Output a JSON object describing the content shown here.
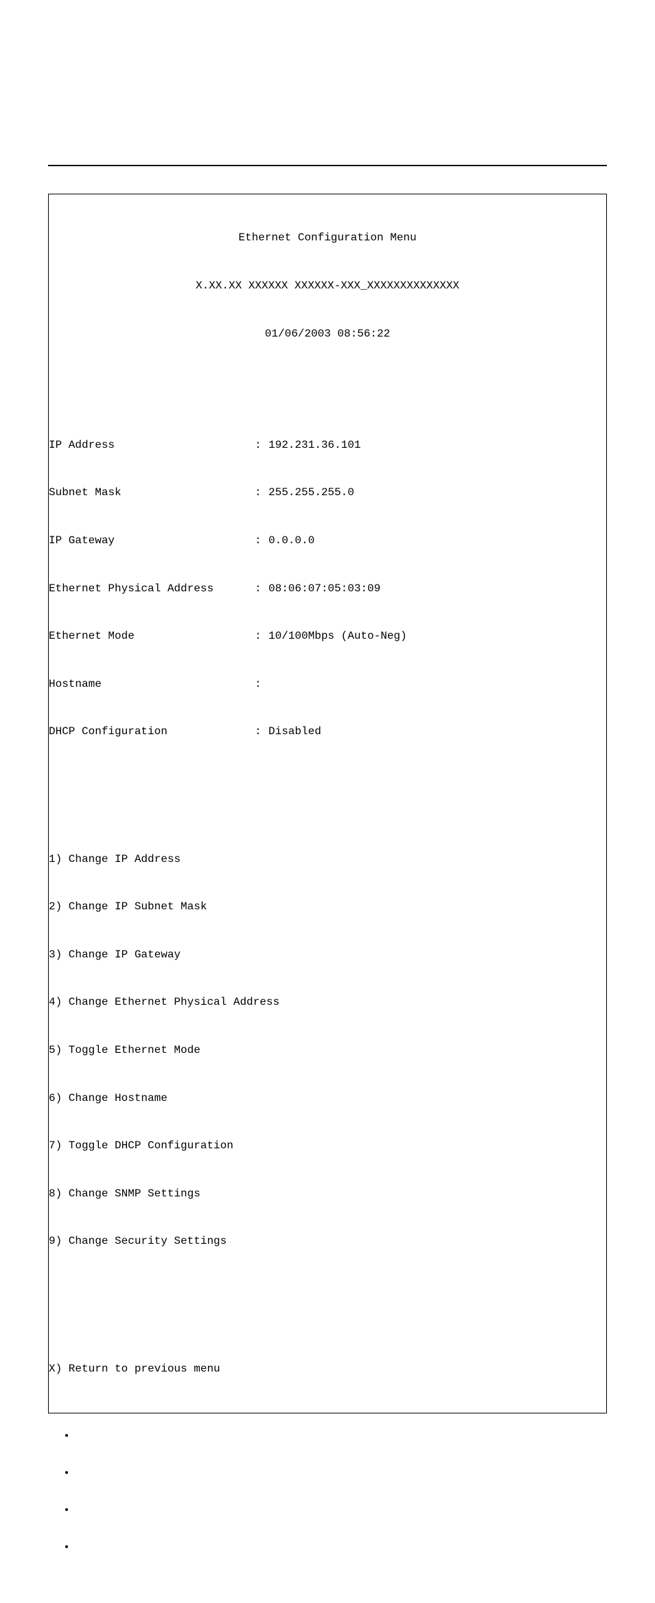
{
  "terminal": {
    "title": "Ethernet Configuration Menu",
    "version_line": "X.XX.XX XXXXXX XXXXXX-XXX_XXXXXXXXXXXXXX",
    "datetime": "01/06/2003 08:56:22",
    "fields": [
      {
        "label": "IP Address",
        "value": "192.231.36.101"
      },
      {
        "label": "Subnet Mask",
        "value": "255.255.255.0"
      },
      {
        "label": "IP Gateway",
        "value": "0.0.0.0"
      },
      {
        "label": "Ethernet Physical Address",
        "value": "08:06:07:05:03:09"
      },
      {
        "label": "Ethernet Mode",
        "value": "10/100Mbps (Auto-Neg)"
      },
      {
        "label": "Hostname",
        "value": ""
      },
      {
        "label": "DHCP Configuration",
        "value": "Disabled"
      }
    ],
    "menu": [
      "1) Change IP Address",
      "2) Change IP Subnet Mask",
      "3) Change IP Gateway",
      "4) Change Ethernet Physical Address",
      "5) Toggle Ethernet Mode",
      "6) Change Hostname",
      "7) Toggle DHCP Configuration",
      "8) Change SNMP Settings",
      "9) Change Security Settings"
    ],
    "return_line": "X) Return to previous menu"
  },
  "bullets": [
    "",
    "",
    "",
    ""
  ]
}
